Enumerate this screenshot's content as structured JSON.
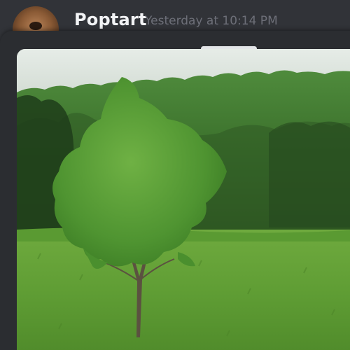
{
  "message": {
    "username": "Poptart",
    "timestamp": "Yesterday at 10:14 PM",
    "avatar_icon": "avatar-icon"
  },
  "sheet": {
    "handle_icon": "drag-handle-icon"
  },
  "attachment": {
    "kind": "photo"
  },
  "colors": {
    "background": "#313338",
    "sheet": "#2b2d31",
    "username": "#f2f3f5",
    "timestamp": "#6d6f78",
    "handle": "#e3e5e8"
  }
}
